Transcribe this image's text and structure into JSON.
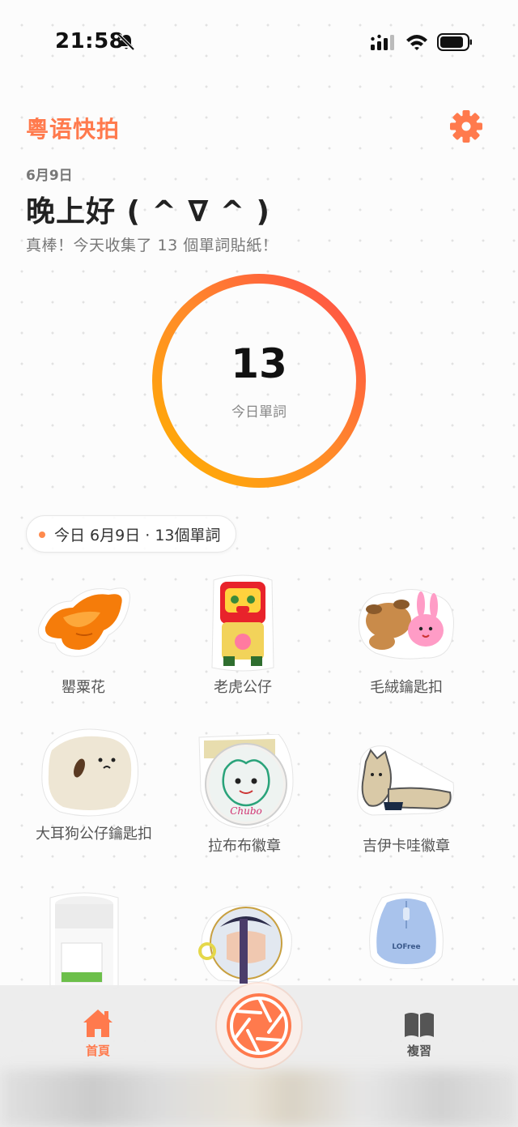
{
  "status_bar": {
    "time": "21:58"
  },
  "header": {
    "app_title": "粵语快拍",
    "date": "6月9日",
    "greeting": "晚上好 ( ^ ∇ ^ )",
    "subtitle": "真棒！今天收集了 13 個單詞貼紙！"
  },
  "progress": {
    "count": "13",
    "label": "今日單詞"
  },
  "day_pill": {
    "text": "今日 6月9日 · 13個單詞"
  },
  "stickers": [
    {
      "label": "罌粟花",
      "icon": "poppy-flower-sticker"
    },
    {
      "label": "老虎公仔",
      "icon": "tiger-toy-sticker"
    },
    {
      "label": "毛絨鑰匙扣",
      "icon": "plush-keychain-sticker"
    },
    {
      "label": "大耳狗公仔鑰匙扣",
      "icon": "big-ear-dog-keychain-sticker"
    },
    {
      "label": "拉布布徽章",
      "icon": "labubu-badge-sticker",
      "badge_text": "Chubo"
    },
    {
      "label": "吉伊卡哇徽章",
      "icon": "chiikawa-badge-sticker"
    },
    {
      "label": "",
      "icon": "white-jar-sticker"
    },
    {
      "label": "",
      "icon": "round-badge-sticker"
    },
    {
      "label": "",
      "icon": "blue-mouse-sticker",
      "brand_text": "LOFree"
    }
  ],
  "tab_bar": {
    "home_label": "首頁",
    "review_label": "複習",
    "active_color": "#ff7a4d",
    "inactive_color": "#555555"
  },
  "colors": {
    "accent": "#ff7a4d",
    "ring_start": "#ffb000",
    "ring_end": "#ff4a4a"
  }
}
